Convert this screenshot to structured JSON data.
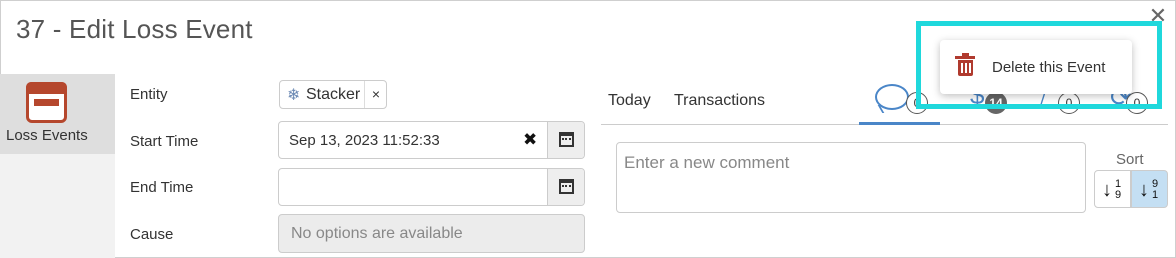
{
  "window": {
    "title": "37 - Edit Loss Event",
    "close_glyph": "✕"
  },
  "nav": {
    "items": [
      {
        "label": "Loss Events",
        "icon": "loss-event-icon",
        "accent": "#b5472d"
      }
    ]
  },
  "form": {
    "entity": {
      "label": "Entity",
      "chip_text": "Stacker",
      "chip_icon": "❄",
      "chip_remove": "×"
    },
    "start_time": {
      "label": "Start Time",
      "value": "Sep 13, 2023 11:52:33",
      "clear_glyph": "✖"
    },
    "end_time": {
      "label": "End Time",
      "value": ""
    },
    "cause": {
      "label": "Cause",
      "placeholder": "No options are available"
    }
  },
  "panel": {
    "tabs": [
      {
        "label": "Today"
      },
      {
        "label": "Transactions"
      }
    ],
    "icon_tabs": [
      {
        "icon": "comments-icon",
        "count": "0",
        "active": true
      },
      {
        "icon": "money-icon",
        "count": "14"
      },
      {
        "icon": "attachment-icon",
        "count": "0"
      },
      {
        "icon": "link-icon",
        "count": "0"
      }
    ],
    "comment": {
      "placeholder": "Enter a new comment"
    },
    "sort": {
      "label": "Sort",
      "asc": {
        "top": "1",
        "bottom": "9"
      },
      "desc": {
        "top": "9",
        "bottom": "1"
      }
    }
  },
  "context_menu": {
    "items": [
      {
        "label": "Delete this Event",
        "icon": "trash-icon"
      }
    ]
  },
  "colors": {
    "accent": "#4a86c8",
    "highlight": "#1fd8dc",
    "danger": "#b03a2e"
  }
}
